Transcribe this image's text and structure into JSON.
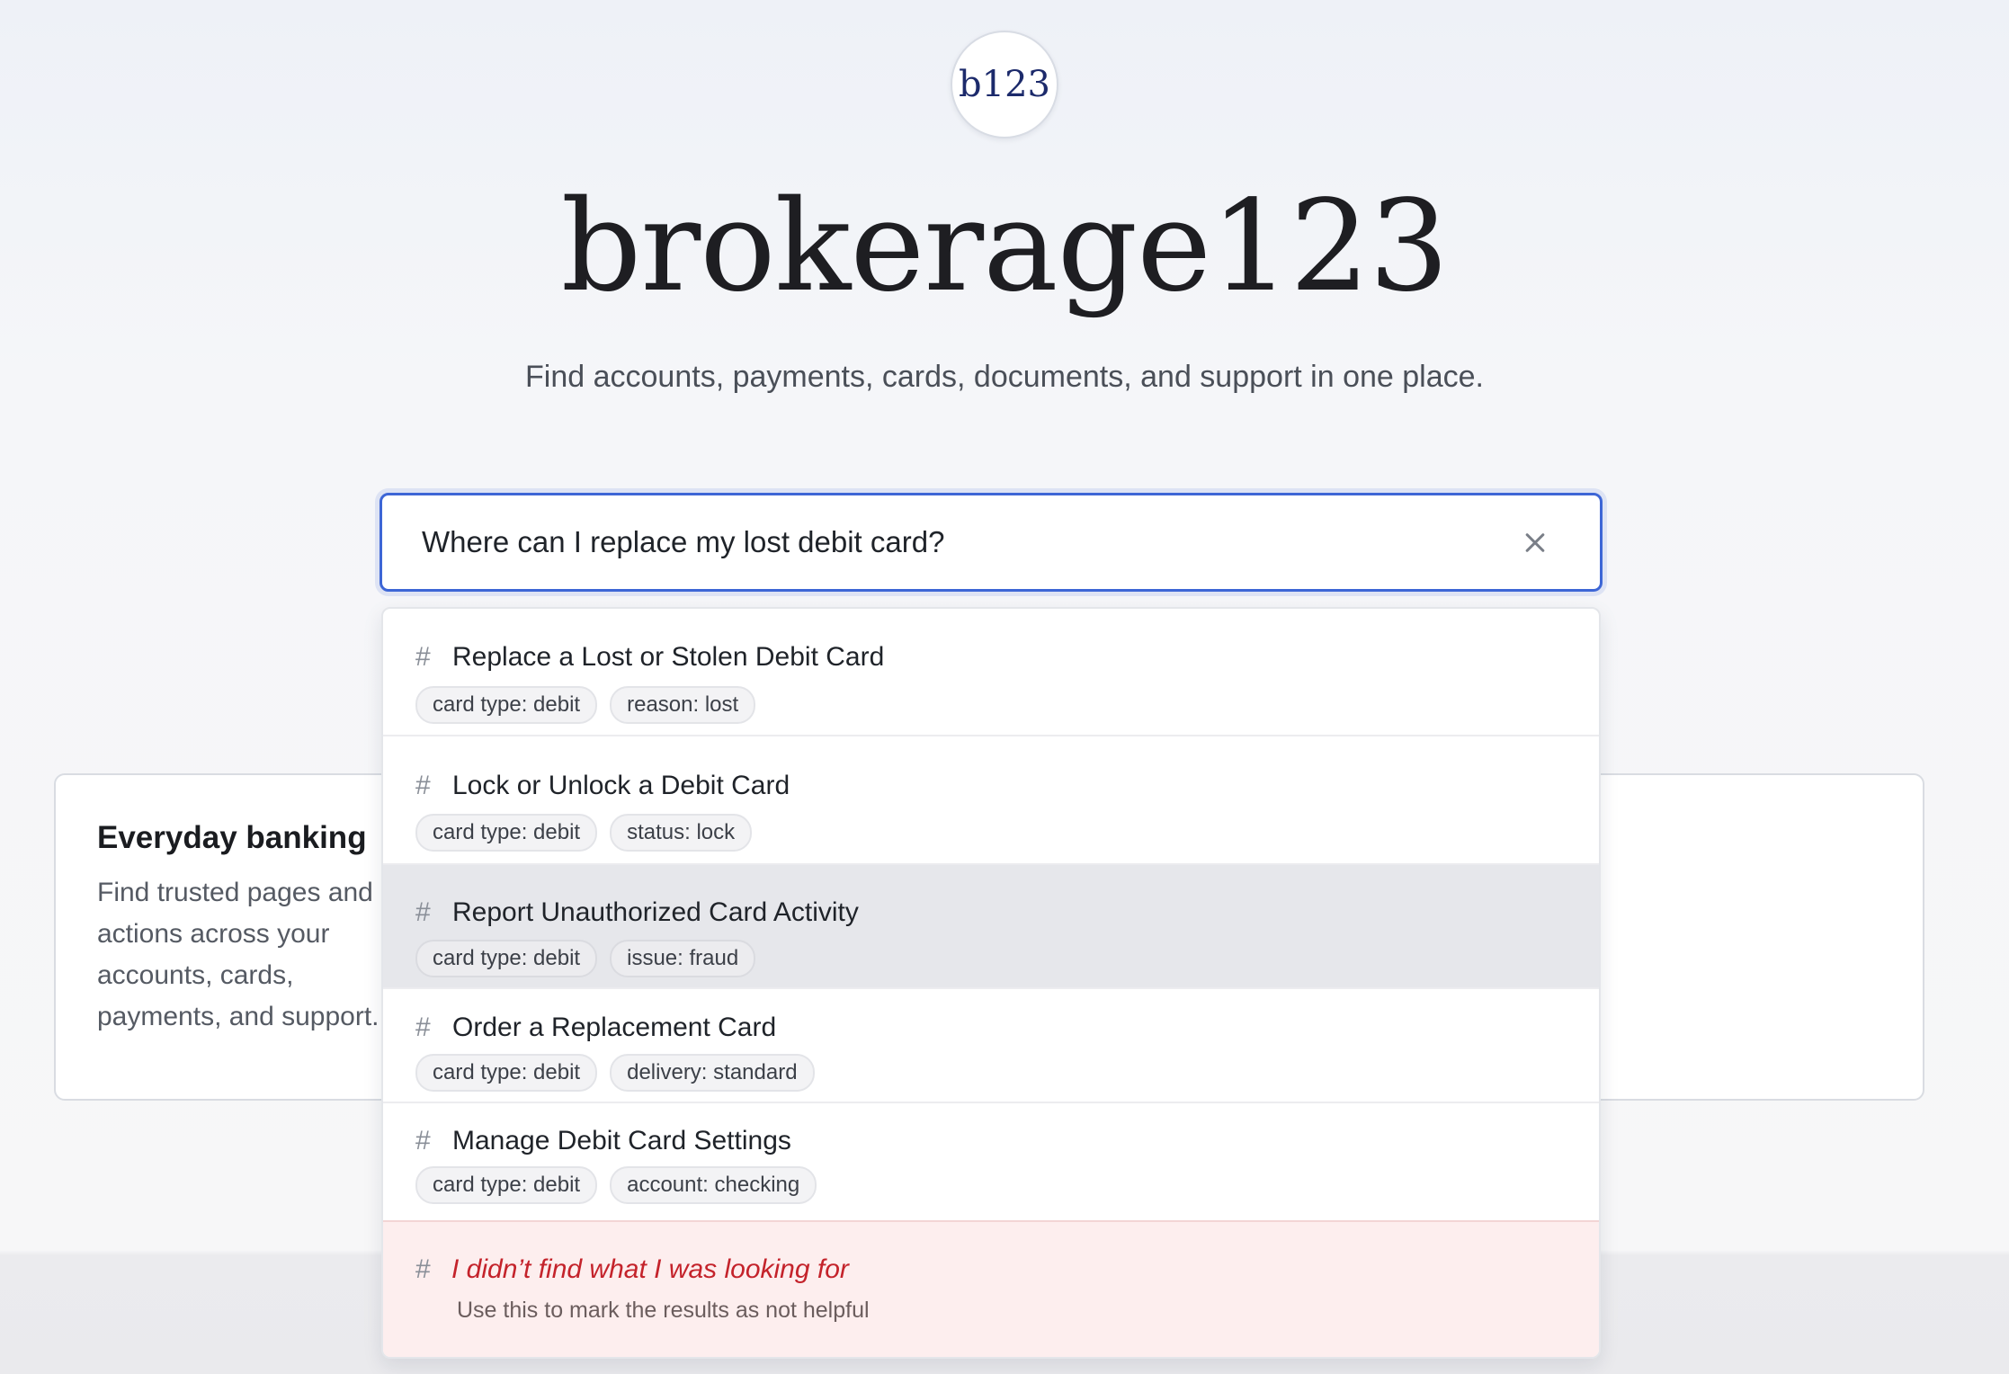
{
  "brand": {
    "logo_text": "b123",
    "title": "brokerage123",
    "tagline": "Find accounts, payments, cards, documents, and support in one place."
  },
  "search": {
    "value": "Where can I replace my lost debit card?",
    "clear_icon": "close-icon"
  },
  "card": {
    "title": "Everyday banking",
    "description": "Find trusted pages and actions across your accounts, cards, payments, and support."
  },
  "results": [
    {
      "title": "Replace a Lost or Stolen Debit Card",
      "tags": [
        "card type: debit",
        "reason: lost"
      ],
      "active": false
    },
    {
      "title": "Lock or Unlock a Debit Card",
      "tags": [
        "card type: debit",
        "status: lock"
      ],
      "active": false
    },
    {
      "title": "Report Unauthorized Card Activity",
      "tags": [
        "card type: debit",
        "issue: fraud"
      ],
      "active": true
    },
    {
      "title": "Order a Replacement Card",
      "tags": [
        "card type: debit",
        "delivery: standard"
      ],
      "active": false
    },
    {
      "title": "Manage Debit Card Settings",
      "tags": [
        "card type: debit",
        "account: checking"
      ],
      "active": false
    }
  ],
  "result_icon": "#",
  "fallback": {
    "title": "I didn’t find what I was looking for",
    "subtitle": "Use this to mark the results as not helpful"
  },
  "colors": {
    "accent": "#3d66d6",
    "fallback_text": "#c4232b",
    "fallback_bg": "#fdeeee"
  }
}
